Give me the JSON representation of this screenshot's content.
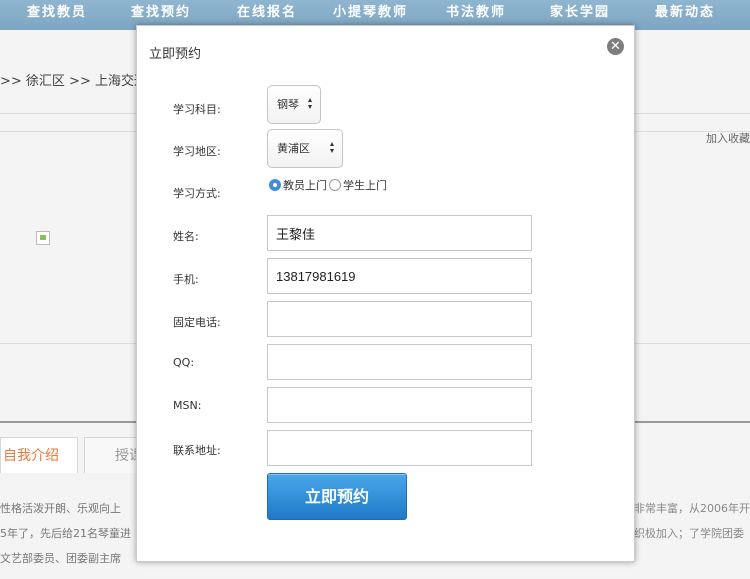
{
  "nav": {
    "items": [
      "查找教员",
      "查找预约",
      "在线报名",
      "小提琴教师",
      "书法教师",
      "家长学园",
      "最新动态"
    ]
  },
  "page": {
    "breadcrumb": ">> 徐汇区 >> 上海交通大",
    "favorite_link": "加入收藏",
    "tabs": [
      "自我介绍",
      "授课"
    ],
    "bio_left": [
      "性格活泼开朗、乐观向上",
      "5年了，先后给21名琴童进",
      "文艺部委员、团委副主席"
    ],
    "bio_right": [
      "非常丰富，从2006年开",
      "织极加入；了学院团委",
      ""
    ]
  },
  "modal": {
    "title": "立即预约",
    "close_icon": "close-icon",
    "subject": {
      "label": "学习科目:",
      "value": "钢琴"
    },
    "district": {
      "label": "学习地区:",
      "value": "黄浦区"
    },
    "mode": {
      "label": "学习方式:",
      "options": [
        "教员上门",
        "学生上门"
      ],
      "selected": "教员上门"
    },
    "name": {
      "label": "姓名:",
      "value": "王黎佳"
    },
    "mobile": {
      "label": "手机:",
      "value": "13817981619"
    },
    "phone": {
      "label": "固定电话:",
      "value": ""
    },
    "qq": {
      "label": "QQ:",
      "value": ""
    },
    "msn": {
      "label": "MSN:",
      "value": ""
    },
    "address": {
      "label": "联系地址:",
      "value": ""
    },
    "submit_label": "立即预约"
  },
  "colors": {
    "nav_bg": "#8fb5cf",
    "submit_bg": "#2a8ad8",
    "tab_active_text": "#e87a3e",
    "radio_selected": "#3e8ed8"
  }
}
